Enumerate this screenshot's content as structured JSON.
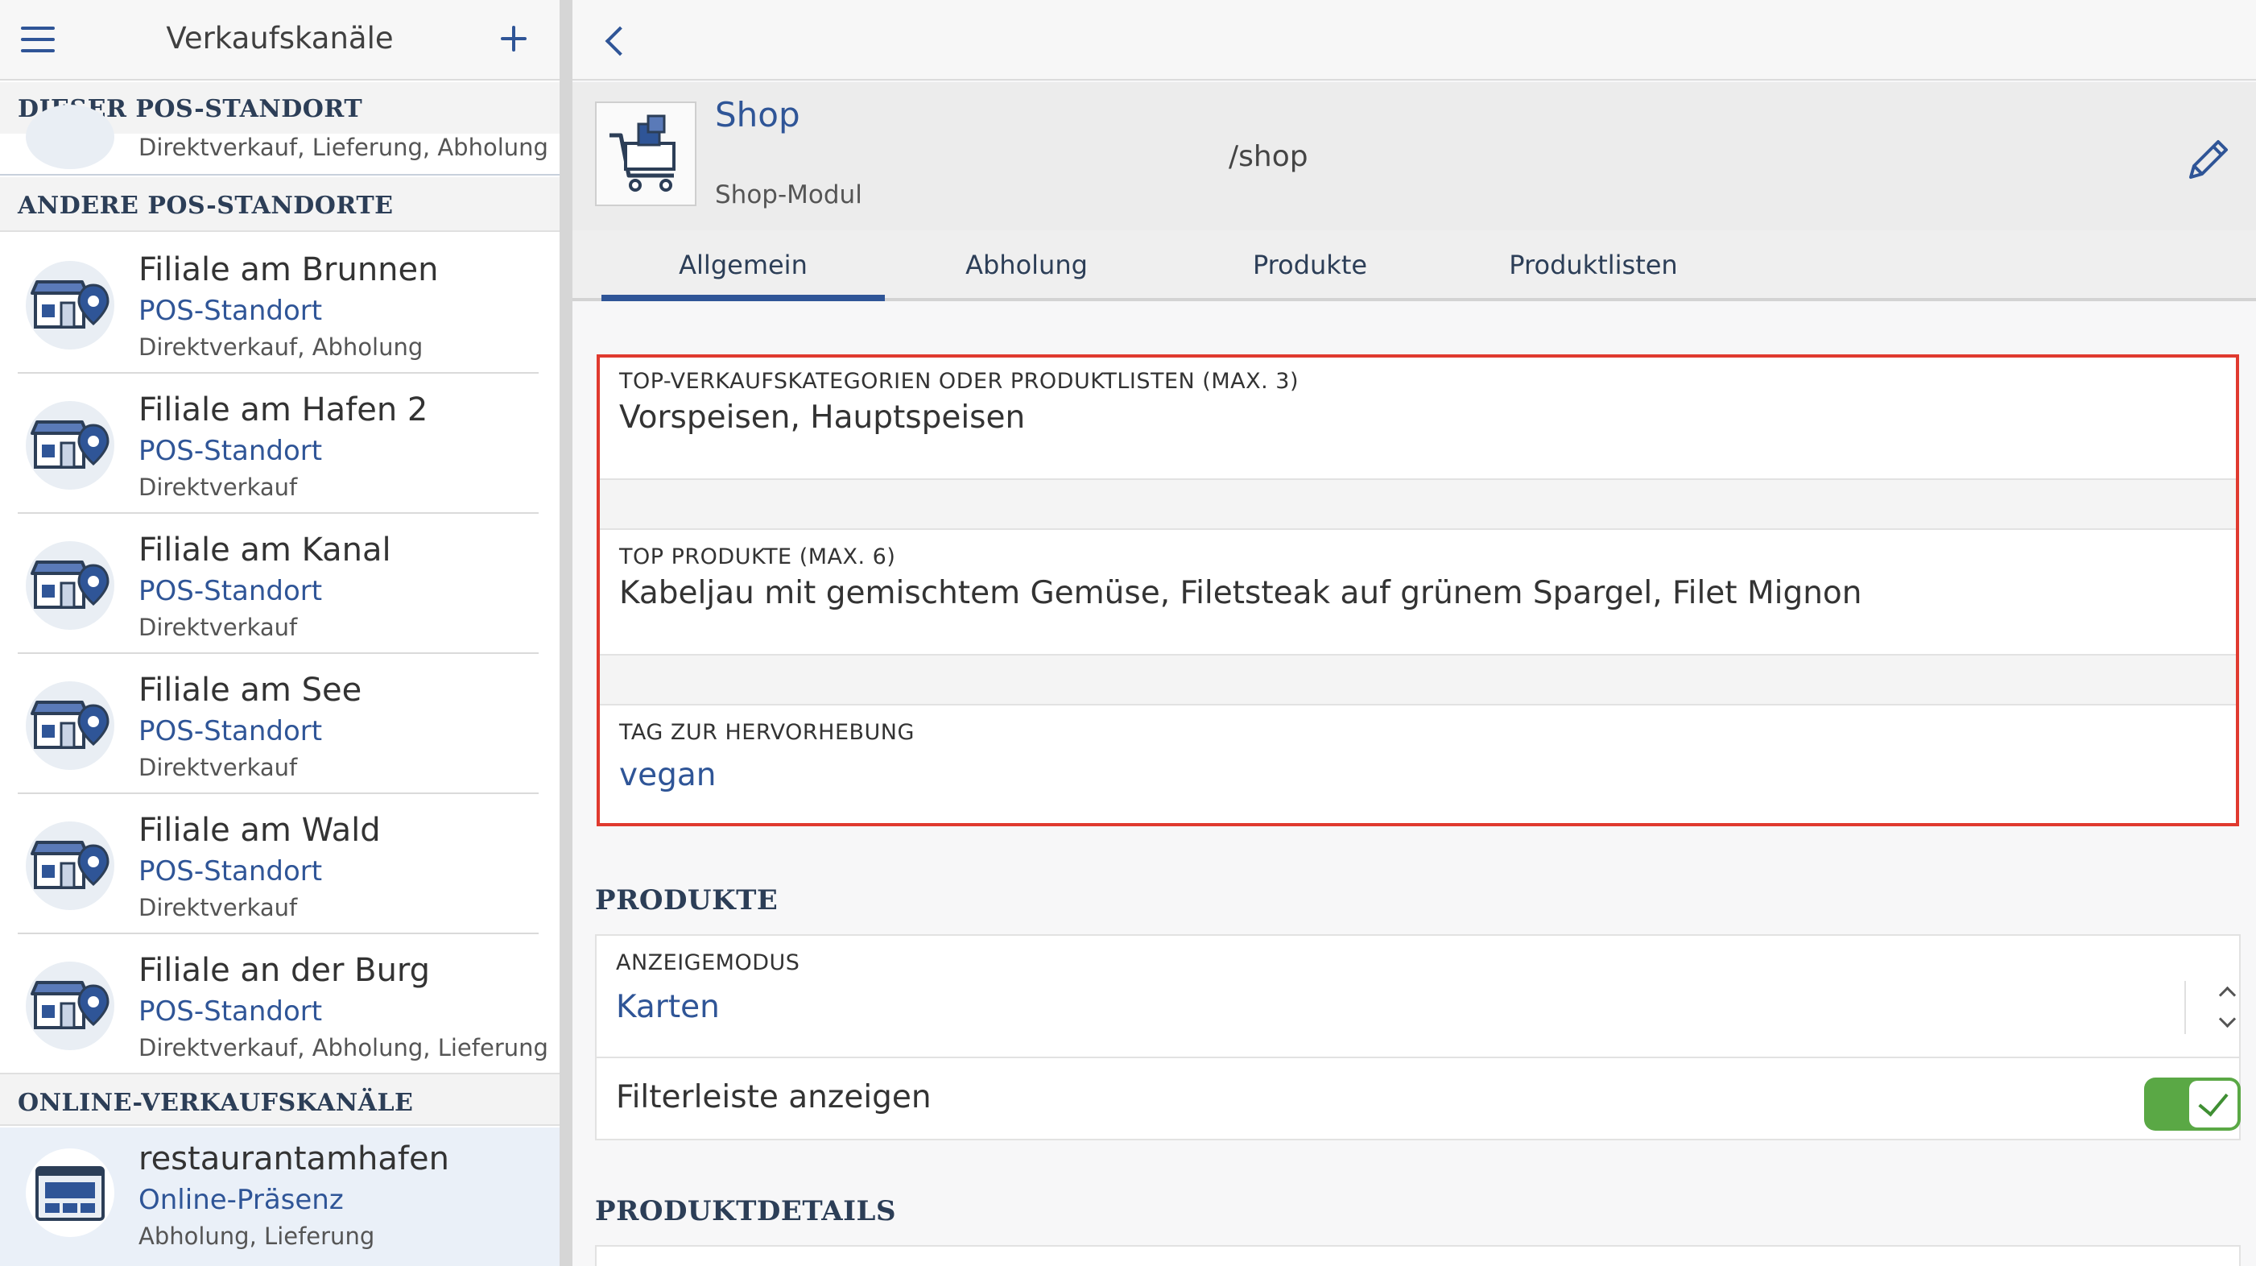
{
  "left_pane": {
    "title": "Verkaufskanäle",
    "sections": {
      "this_pos": "DIESER POS-STANDORT",
      "other_pos": "ANDERE POS-STANDORTE",
      "online": "ONLINE-VERKAUFSKANÄLE"
    },
    "this_pos_item": {
      "channels": "Direktverkauf, Lieferung, Abholung"
    },
    "other_pos_items": [
      {
        "name": "Filiale am Brunnen",
        "kind": "POS-Standort",
        "channels": "Direktverkauf, Abholung"
      },
      {
        "name": "Filiale am Hafen 2",
        "kind": "POS-Standort",
        "channels": "Direktverkauf"
      },
      {
        "name": "Filiale am Kanal",
        "kind": "POS-Standort",
        "channels": "Direktverkauf"
      },
      {
        "name": "Filiale am See",
        "kind": "POS-Standort",
        "channels": "Direktverkauf"
      },
      {
        "name": "Filiale am Wald",
        "kind": "POS-Standort",
        "channels": "Direktverkauf"
      },
      {
        "name": "Filiale an der Burg",
        "kind": "POS-Standort",
        "channels": "Direktverkauf, Abholung, Lieferung"
      }
    ],
    "online_items": [
      {
        "name": "restaurantamhafen",
        "kind": "Online-Präsenz",
        "channels": "Abholung, Lieferung"
      }
    ]
  },
  "module": {
    "title": "Shop",
    "subtitle": "Shop-Modul",
    "path": "/shop"
  },
  "tabs": [
    {
      "label": "Allgemein",
      "active": true
    },
    {
      "label": "Abholung",
      "active": false
    },
    {
      "label": "Produkte",
      "active": false
    },
    {
      "label": "Produktlisten",
      "active": false
    }
  ],
  "highlights": {
    "top_categories_label": "TOP-VERKAUFSKATEGORIEN ODER PRODUKTLISTEN (MAX. 3)",
    "top_categories_value": "Vorspeisen, Hauptspeisen",
    "top_products_label": "TOP PRODUKTE (MAX. 6)",
    "top_products_value": "Kabeljau mit gemischtem Gemüse, Filetsteak auf grünem Spargel, Filet Mignon",
    "highlight_tag_label": "TAG ZUR HERVORHEBUNG",
    "highlight_tag_value": "vegan"
  },
  "produkte": {
    "section_title": "PRODUKTE",
    "display_mode_label": "ANZEIGEMODUS",
    "display_mode_value": "Karten",
    "filter_bar_label": "Filterleiste anzeigen",
    "filter_bar_enabled": true
  },
  "produktdetails": {
    "section_title": "PRODUKTDETAILS"
  },
  "colors": {
    "accent": "#2f5597",
    "highlight_border": "#e03a2f",
    "toggle_on": "#5aa845"
  },
  "icons": {
    "menu": "hamburger-menu-icon",
    "add": "plus-icon",
    "back": "chevron-left-icon",
    "edit": "pencil-icon",
    "store": "store-location-icon",
    "online": "browser-window-icon",
    "module": "shopping-cart-icon"
  }
}
